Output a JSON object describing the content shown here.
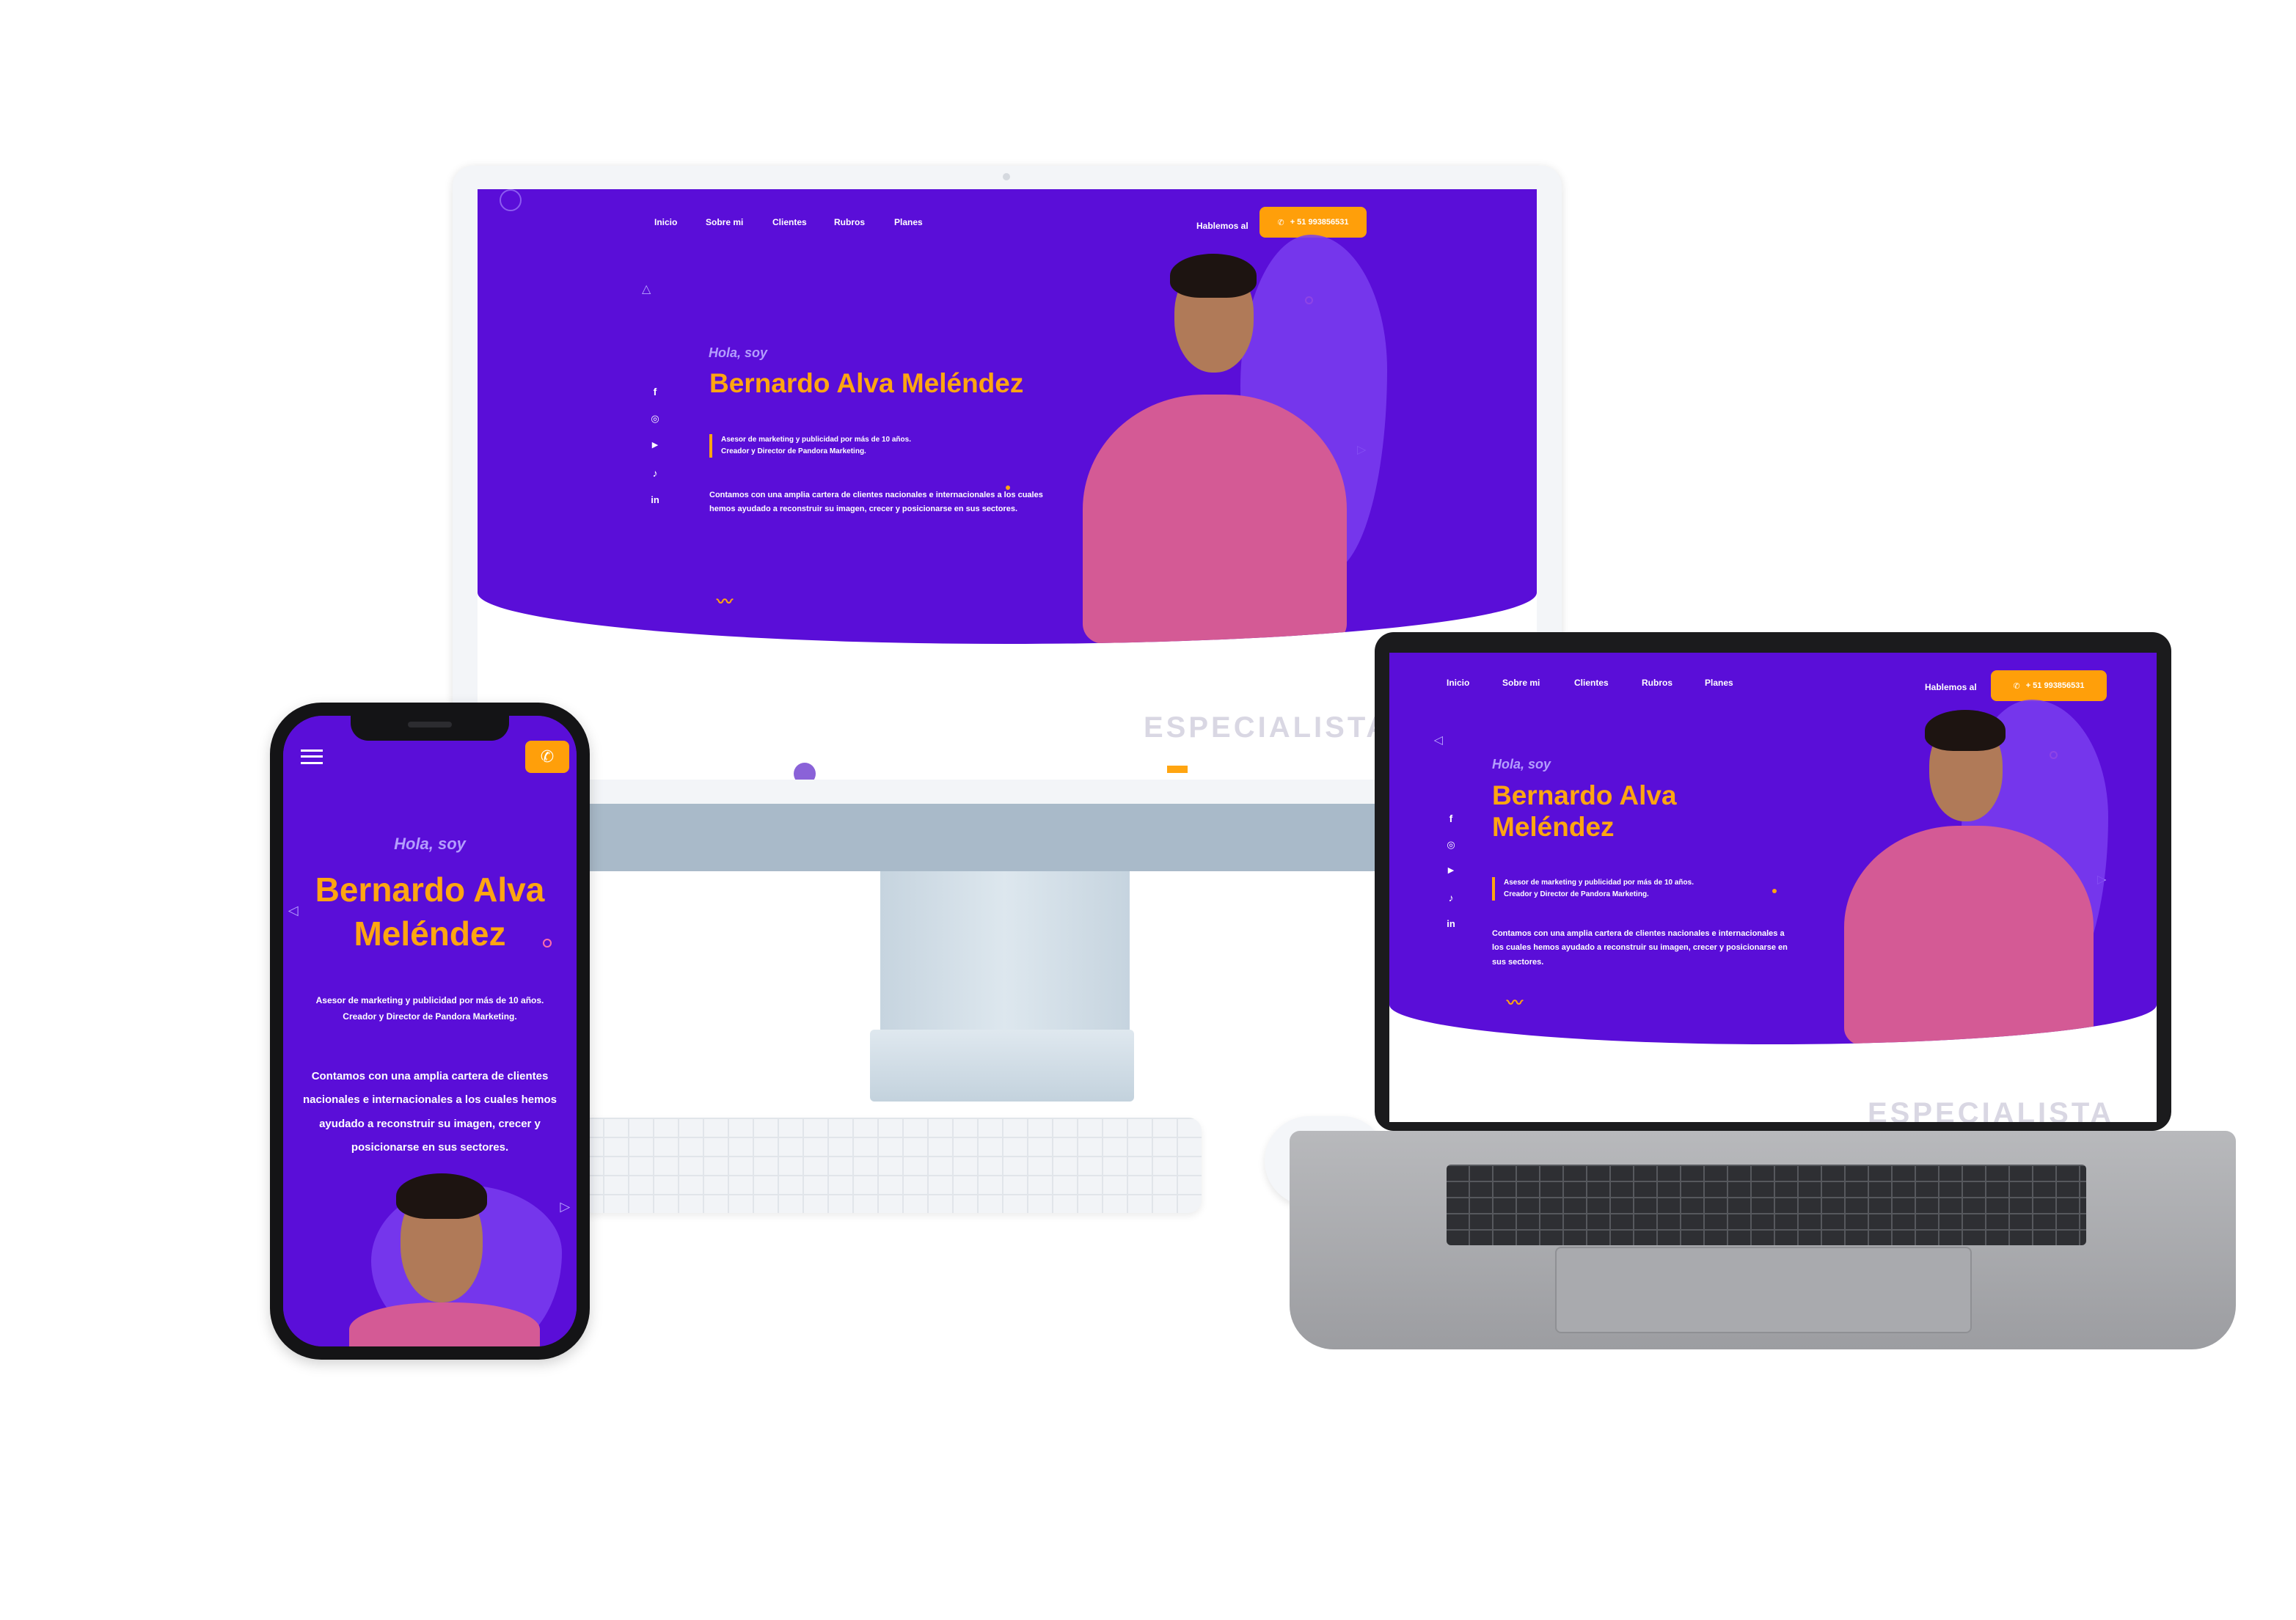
{
  "nav": {
    "items": [
      "Inicio",
      "Sobre mi",
      "Clientes",
      "Rubros",
      "Planes"
    ],
    "contact_label": "Hablemos al",
    "phone": "+ 51 993856531"
  },
  "hero": {
    "greeting": "Hola, soy",
    "name": "Bernardo Alva Meléndez",
    "name_line1": "Bernardo Alva",
    "name_line2": "Meléndez",
    "role_line1": "Asesor de marketing y publicidad por más de 10 años.",
    "role_line2": "Creador y Director de Pandora Marketing.",
    "description": "Contamos con una amplia cartera de clientes nacionales e internacionales a los cuales hemos ayudado a reconstruir su imagen, crecer y posicionarse en sus sectores."
  },
  "section": {
    "specialista": "ESPECIALISTA",
    "specialista_cut": "ESPECIALISTA"
  },
  "social_icons": [
    "facebook-icon",
    "instagram-icon",
    "youtube-icon",
    "tiktok-icon",
    "linkedin-icon"
  ],
  "colors": {
    "hero_bg": "#5a0ed8",
    "accent": "#ffa511",
    "button": "#ff9f0a"
  }
}
